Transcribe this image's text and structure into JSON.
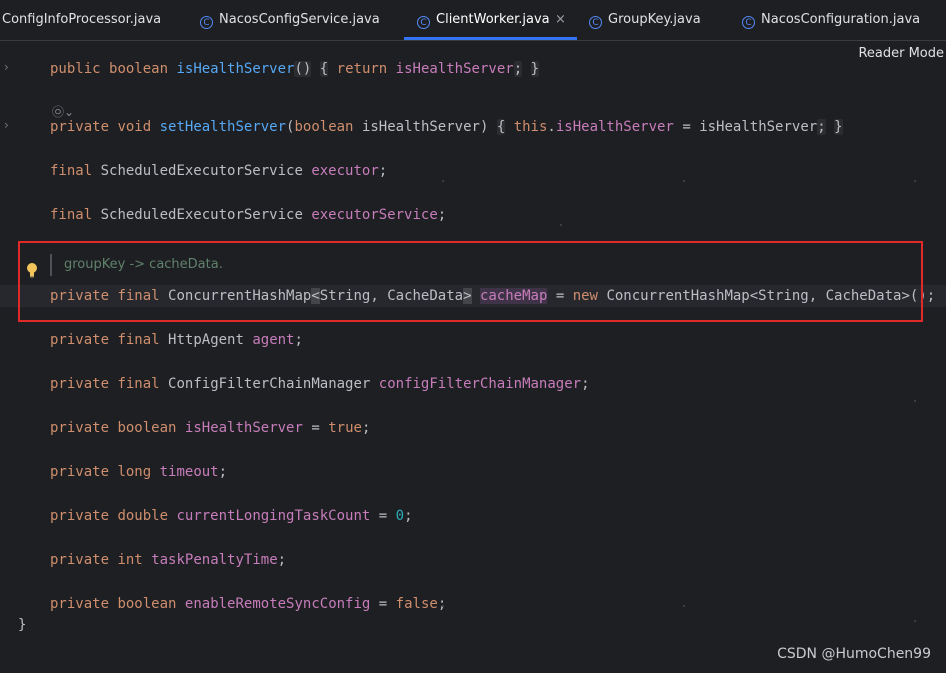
{
  "tabs": [
    {
      "label": "ConfigInfoProcessor.java",
      "icon": "",
      "active": false
    },
    {
      "label": "NacosConfigService.java",
      "icon": "class-icon",
      "active": false
    },
    {
      "label": "ClientWorker.java",
      "icon": "class-icon",
      "active": true
    },
    {
      "label": "GroupKey.java",
      "icon": "class-icon",
      "active": false
    },
    {
      "label": "NacosConfiguration.java",
      "icon": "class-icon",
      "active": false
    }
  ],
  "tab_close_glyph": "×",
  "class_icon_glyph": "C",
  "reader_mode": "Reader Mode",
  "inlay_hint": "㉧⌄",
  "doc_comment": "groupKey -> cacheData.",
  "closing_brace": "}",
  "watermark": "CSDN @HumoChen99",
  "code": {
    "l1": [
      "public",
      "boolean",
      "isHealthServer",
      "()",
      "{",
      "return",
      "isHealthServer",
      ";",
      "}"
    ],
    "l2": [
      "private",
      "void",
      "setHealthServer",
      "(",
      "boolean",
      "isHealthServer",
      ")",
      "{",
      "this",
      ".",
      "isHealthServer",
      "=",
      "isHealthServer",
      ";",
      "}"
    ],
    "l3": [
      "final",
      "ScheduledExecutorService",
      "executor",
      ";"
    ],
    "l4": [
      "final",
      "ScheduledExecutorService",
      "executorService",
      ";"
    ],
    "l5": [
      "private",
      "final",
      "ConcurrentHashMap",
      "<",
      "String, CacheData",
      ">",
      "cacheMap",
      "=",
      "new",
      "ConcurrentHashMap<String, CacheData>();"
    ],
    "l6": [
      "private",
      "final",
      "HttpAgent",
      "agent",
      ";"
    ],
    "l7": [
      "private",
      "final",
      "ConfigFilterChainManager",
      "configFilterChainManager",
      ";"
    ],
    "l8": [
      "private",
      "boolean",
      "isHealthServer",
      "=",
      "true",
      ";"
    ],
    "l9": [
      "private",
      "long",
      "timeout",
      ";"
    ],
    "l10": [
      "private",
      "double",
      "currentLongingTaskCount",
      "=",
      "0",
      ";"
    ],
    "l11": [
      "private",
      "int",
      "taskPenaltyTime",
      ";"
    ],
    "l12": [
      "private",
      "boolean",
      "enableRemoteSyncConfig",
      "=",
      "false",
      ";"
    ]
  },
  "colors": {
    "keyword": "#cf8e6d",
    "method": "#56a8f5",
    "field": "#c77dbb",
    "number": "#2aacb8",
    "text": "#bcbec4",
    "highlight_box": "#e02a2a",
    "active_tab_underline": "#3574f0",
    "background": "#1e1f22"
  }
}
